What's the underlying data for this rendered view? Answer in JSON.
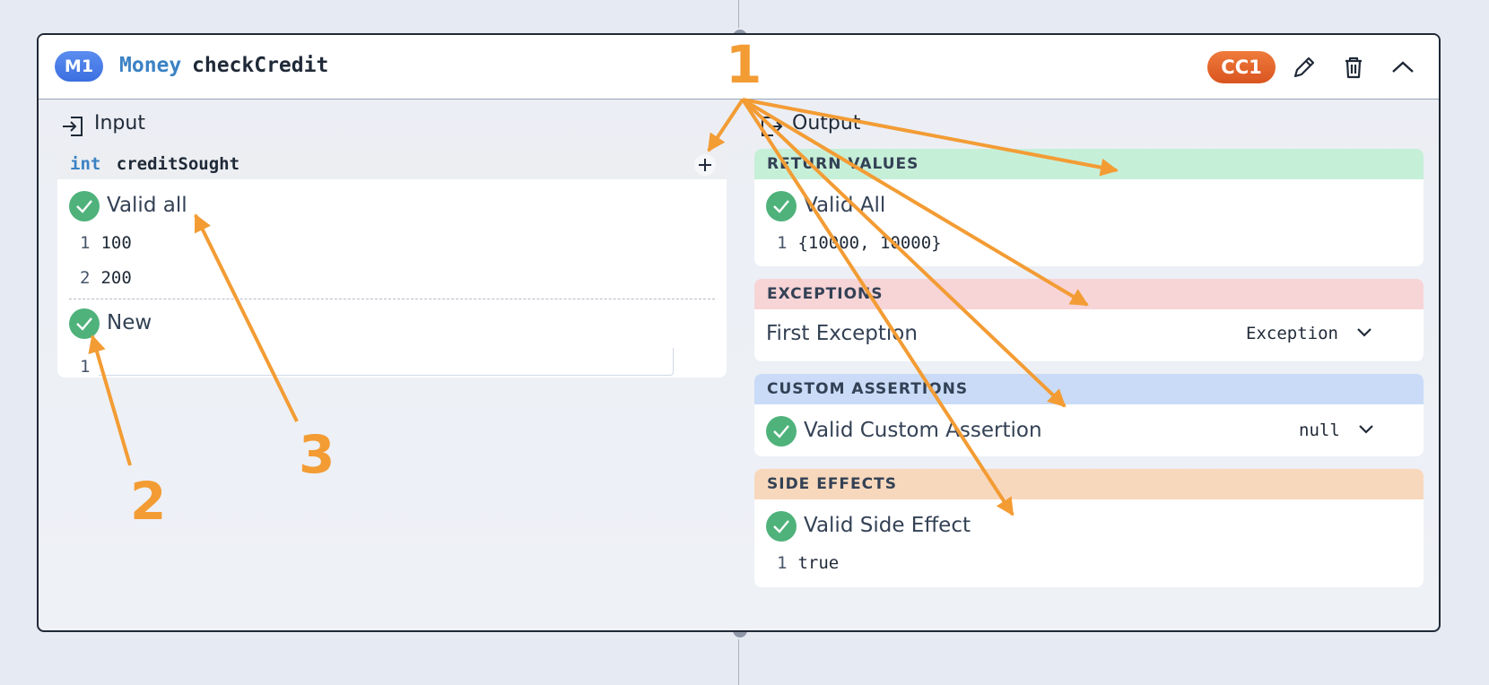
{
  "header": {
    "badge": "M1",
    "class_name": "Money",
    "method_name": "checkCredit",
    "cc_badge": "CC1",
    "icons": [
      "pencil-icon",
      "trash-icon",
      "chevron-up-icon"
    ]
  },
  "input": {
    "title": "Input",
    "param_type": "int",
    "param_name": "creditSought",
    "groups": [
      {
        "label": "Valid all",
        "rows": [
          {
            "n": "1",
            "v": "100"
          },
          {
            "n": "2",
            "v": "200"
          }
        ]
      },
      {
        "label": "New",
        "rows": [
          {
            "n": "1",
            "v": ""
          }
        ]
      }
    ]
  },
  "output": {
    "title": "Output",
    "return_values": {
      "header": "RETURN VALUES",
      "label": "Valid All",
      "row_n": "1",
      "row_v": "{10000, 10000}"
    },
    "exceptions": {
      "header": "EXCEPTIONS",
      "label": "First Exception",
      "dropdown": "Exception"
    },
    "custom_assertions": {
      "header": "CUSTOM ASSERTIONS",
      "label": "Valid Custom Assertion",
      "dropdown": "null"
    },
    "side_effects": {
      "header": "SIDE EFFECTS",
      "label": "Valid Side Effect",
      "row_n": "1",
      "row_v": "true"
    }
  },
  "annotations": [
    "1",
    "2",
    "3"
  ],
  "colors": {
    "return_values": "#c6efd8",
    "exceptions": "#f7d4d6",
    "custom_assertions": "#c9dbf7",
    "side_effects": "#f8d8bd",
    "annotation": "#f39c34",
    "check": "#4fb27b"
  }
}
